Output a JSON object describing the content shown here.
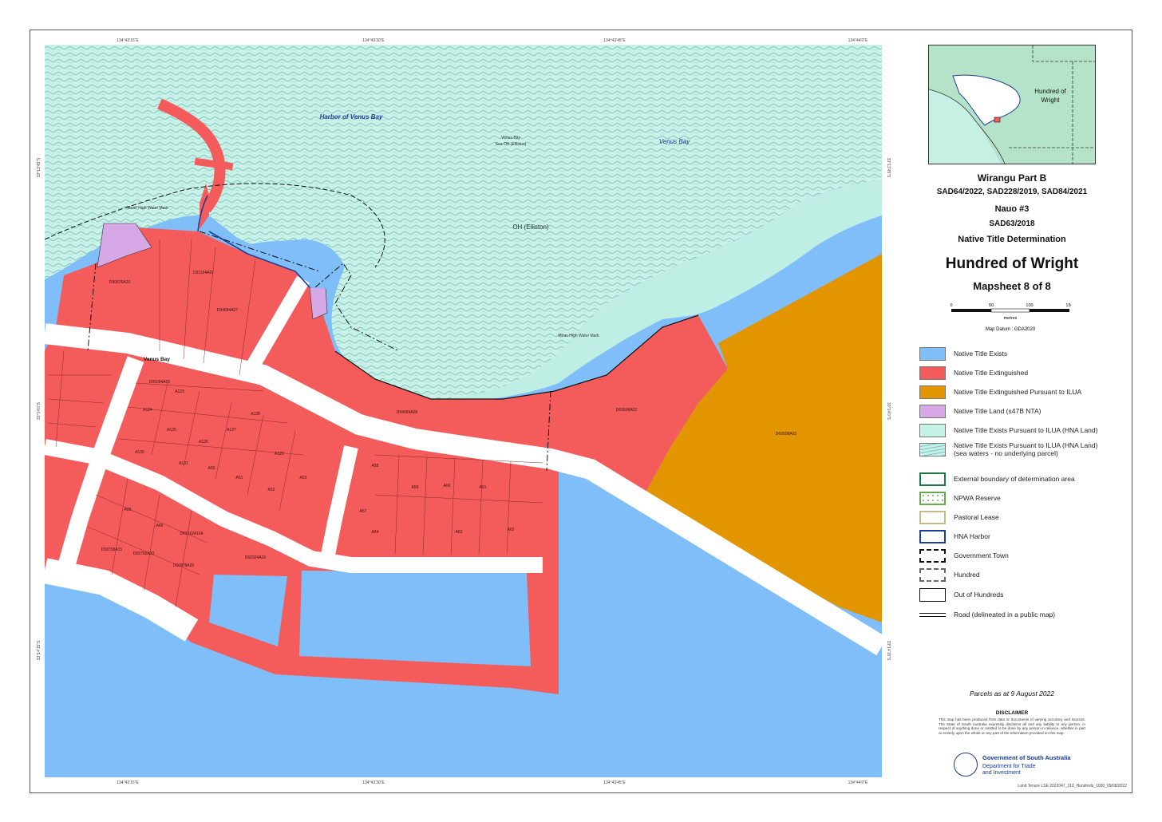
{
  "map": {
    "water_labels": {
      "harbor": "Harbor of Venus Bay",
      "bay": "Venus Bay",
      "bay_small": "Venus Bay\nSea OH (Elliston)",
      "oh": "OH (Elliston)",
      "town": "Venus Bay",
      "mhw_left": "Mean High Water Mark\nApproximate Boundary Tide",
      "mhw_right": "Mean High Water Mark\nAmbulatory Boundary Tide"
    },
    "parcel_labels": [
      "D90676A20",
      "D91154A01",
      "D94684A07",
      "D94684A08",
      "D69508A02",
      "D69508A03",
      "D65054A05",
      "A123",
      "A124",
      "A125",
      "A126",
      "A127",
      "A128",
      "A129",
      "A130",
      "A131",
      "A50",
      "A51",
      "A52",
      "A53",
      "A57",
      "A58",
      "A59",
      "A60",
      "A61",
      "A62",
      "A63",
      "A64",
      "A65",
      "A66",
      "D62162A164",
      "D58758A15",
      "D59765A20",
      "D60978A26",
      "D62924A26"
    ],
    "grid_ticks_top": [
      "134°43'15\"E",
      "134°43'30\"E",
      "134°43'45\"E",
      "134°44'0\"E"
    ],
    "grid_ticks_bottom": [
      "134°43'15\"E",
      "134°43'30\"E",
      "134°43'45\"E",
      "134°44'0\"E"
    ],
    "grid_ticks_left": [
      "33°13'45\"S",
      "33°14'0\"S",
      "33°14'15\"S"
    ],
    "grid_ticks_right": [
      "33°13'45\"S",
      "33°14'0\"S",
      "33°14'15\"S"
    ]
  },
  "inset": {
    "label": "Hundred of\nWright"
  },
  "title": {
    "line1": "Wirangu Part B",
    "line2": "SAD64/2022, SAD228/2019, SAD84/2021",
    "line3": "Nauo #3",
    "line4": "SAD63/2018",
    "line5": "Native Title Determination",
    "main": "Hundred of Wright",
    "mapsheet": "Mapsheet 8 of 8"
  },
  "scale": {
    "ticks": [
      "0",
      "50",
      "100",
      "150"
    ],
    "unit": "metres",
    "datum": "Map Datum : GDA2020"
  },
  "legend": [
    {
      "label": "Native Title Exists",
      "fill": "#7fbef9",
      "pattern": "solid"
    },
    {
      "label": "Native Title Extinguished",
      "fill": "#f45b5b",
      "pattern": "solid"
    },
    {
      "label": "Native Title Extinguished Pursuant to ILUA",
      "fill": "#e39500",
      "pattern": "solid"
    },
    {
      "label": "Native Title Land (s47B NTA)",
      "fill": "#d6a8e6",
      "pattern": "solid"
    },
    {
      "label": "Native Title Exists Pursuant to ILUA (HNA Land)",
      "fill": "#c4f2e6",
      "pattern": "solid"
    },
    {
      "label": "Native Title Exists Pursuant to ILUA (HNA Land)\n(sea waters - no underlying parcel)",
      "fill": "#b7e8e0",
      "pattern": "waves"
    },
    {
      "label": "External boundary of determination area",
      "fill": "#ffffff",
      "pattern": "green-border"
    },
    {
      "label": "NPWA Reserve",
      "fill": "#ffffff",
      "pattern": "dots"
    },
    {
      "label": "Pastoral Lease",
      "fill": "#ffffff",
      "pattern": "tan-border"
    },
    {
      "label": "HNA Harbor",
      "fill": "#ffffff",
      "pattern": "blue-border"
    },
    {
      "label": "Government Town",
      "fill": "#ffffff",
      "pattern": "dash-dot"
    },
    {
      "label": "Hundred",
      "fill": "#ffffff",
      "pattern": "dashed"
    },
    {
      "label": "Out of Hundreds",
      "fill": "#ffffff",
      "pattern": "black-border"
    },
    {
      "label": "Road (delineated in a public map)",
      "fill": "#ffffff",
      "pattern": "road"
    }
  ],
  "footer": {
    "parcels_date": "Parcels as at 9 August 2022",
    "disclaimer_title": "DISCLAIMER",
    "disclaimer_text": "This map has been produced from data or documents of varying accuracy and sources. The State of South Australia expressly disclaims all and any liability to any person, in respect of anything done or omitted to be done by any person in reliance, whether in part or entirely upon the whole or any part of the information provided on this map.",
    "gov_name": "Government of South Australia",
    "dept_name": "Department for Trade\nand Investment",
    "ref": "Land Tenure LSE 2022047_310_Hundreds_1030_09/08/2022"
  },
  "colors": {
    "sea": "#7fbef9",
    "hna": "#bfeee4",
    "extinguished": "#f45b5b",
    "ilua": "#e39500",
    "s47b": "#d6a8e6",
    "road": "#ffffff",
    "harbor_line": "#1d3f9a"
  }
}
